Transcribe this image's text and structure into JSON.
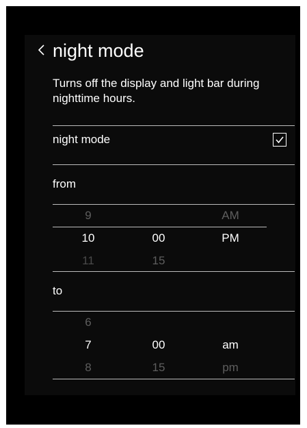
{
  "header": {
    "back_icon": "chevron-left-icon",
    "title": "night mode"
  },
  "description": "Turns off the display and light bar during nighttime hours.",
  "night_mode_row": {
    "label": "night mode",
    "checked": true,
    "icon": "checkbox-checked-icon"
  },
  "from": {
    "label": "from",
    "hour": {
      "prev": "9",
      "current": "10",
      "next": "11"
    },
    "minute": {
      "prev": "",
      "current": "00",
      "next": "15"
    },
    "period": {
      "prev": "AM",
      "current": "PM",
      "next": ""
    }
  },
  "to": {
    "label": "to",
    "hour": {
      "prev": "6",
      "current": "7",
      "next": "8"
    },
    "minute": {
      "prev": "",
      "current": "00",
      "next": "15"
    },
    "period": {
      "prev": "",
      "current": "am",
      "next": "pm"
    }
  },
  "colors": {
    "background": "#000000",
    "panel": "#0b0b0b",
    "text": "#ffffff",
    "muted": "#5e5e5e",
    "divider": "#bdbdbd"
  }
}
